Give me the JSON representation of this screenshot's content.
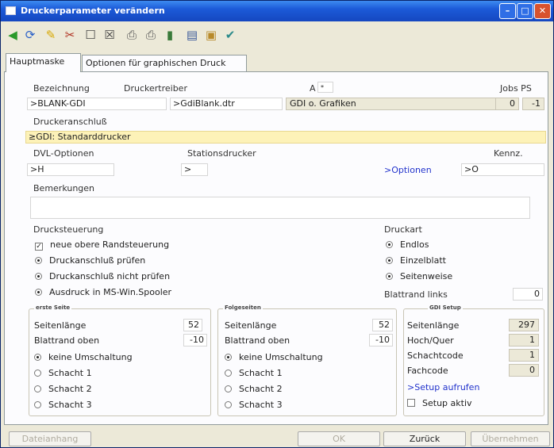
{
  "window": {
    "title": "Druckerparameter verändern"
  },
  "tabs": [
    "Hauptmaske",
    "Optionen für graphischen Druck"
  ],
  "labels": {
    "bezeichnung": "Bezeichnung",
    "druckertreiber": "Druckertreiber",
    "a": "A",
    "jobs_ps": "Jobs PS",
    "druckeranschluss": "Druckeranschluß",
    "dvl_optionen": "DVL-Optionen",
    "stationsdrucker": "Stationsdrucker",
    "kennz": "Kennz.",
    "bemerkungen": "Bemerkungen",
    "drucksteuerung": "Drucksteuerung",
    "druckart": "Druckart",
    "blattrand_links": "Blattrand links"
  },
  "fields": {
    "bezeichnung": ">BLANK-GDI",
    "druckertreiber": ">GdiBlank.dtr",
    "treiber_desc": "GDI o. Grafiken",
    "a_value": "*",
    "jobs": "0",
    "ps": "-1",
    "druckeranschluss": "≥GDI: Standarddrucker",
    "dvl_optionen": ">H",
    "stationsdrucker": ">",
    "optionen_link": ">Optionen",
    "kennz": ">O",
    "bemerkungen": "",
    "blattrand_links": "0"
  },
  "drucksteuerung": [
    {
      "label": "neue obere Randsteuerung",
      "type": "check",
      "checked": true
    },
    {
      "label": "Druckanschluß prüfen",
      "type": "radio",
      "checked": true
    },
    {
      "label": "Druckanschluß nicht prüfen",
      "type": "radio",
      "checked": true
    },
    {
      "label": "Ausdruck in MS-Win.Spooler",
      "type": "radio",
      "checked": true
    }
  ],
  "druckart": [
    {
      "label": "Endlos",
      "checked": true
    },
    {
      "label": "Einzelblatt",
      "checked": true
    },
    {
      "label": "Seitenweise",
      "checked": true
    }
  ],
  "erste_seite": {
    "title": "erste Seite",
    "seitenlaenge_label": "Seitenlänge",
    "seitenlaenge": "52",
    "blattrand_label": "Blattrand oben",
    "blattrand": "-10",
    "options": [
      {
        "label": "keine Umschaltung",
        "checked": true
      },
      {
        "label": "Schacht 1",
        "checked": false
      },
      {
        "label": "Schacht 2",
        "checked": false
      },
      {
        "label": "Schacht 3",
        "checked": false
      }
    ]
  },
  "folgeseiten": {
    "title": "Folgeseiten",
    "seitenlaenge_label": "Seitenlänge",
    "seitenlaenge": "52",
    "blattrand_label": "Blattrand oben",
    "blattrand": "-10",
    "options": [
      {
        "label": "keine Umschaltung",
        "checked": true
      },
      {
        "label": "Schacht 1",
        "checked": false
      },
      {
        "label": "Schacht 2",
        "checked": false
      },
      {
        "label": "Schacht 3",
        "checked": false
      }
    ]
  },
  "gdi_setup": {
    "title": "GDI Setup",
    "seitenlaenge_label": "Seitenlänge",
    "seitenlaenge": "297",
    "hochquer_label": "Hoch/Quer",
    "hochquer": "1",
    "schachtcode_label": "Schachtcode",
    "schachtcode": "1",
    "fachcode_label": "Fachcode",
    "fachcode": "0",
    "setup_link": ">Setup aufrufen",
    "setup_aktiv": "Setup aktiv"
  },
  "buttons": {
    "dateianhang": "Dateianhang",
    "ok": "OK",
    "zurueck": "Zurück",
    "uebernehmen": "Übernehmen"
  },
  "colors": {
    "highlight_field": "#fdf2b8",
    "title_bar": "#1c5ad8",
    "link": "#2233cc"
  }
}
